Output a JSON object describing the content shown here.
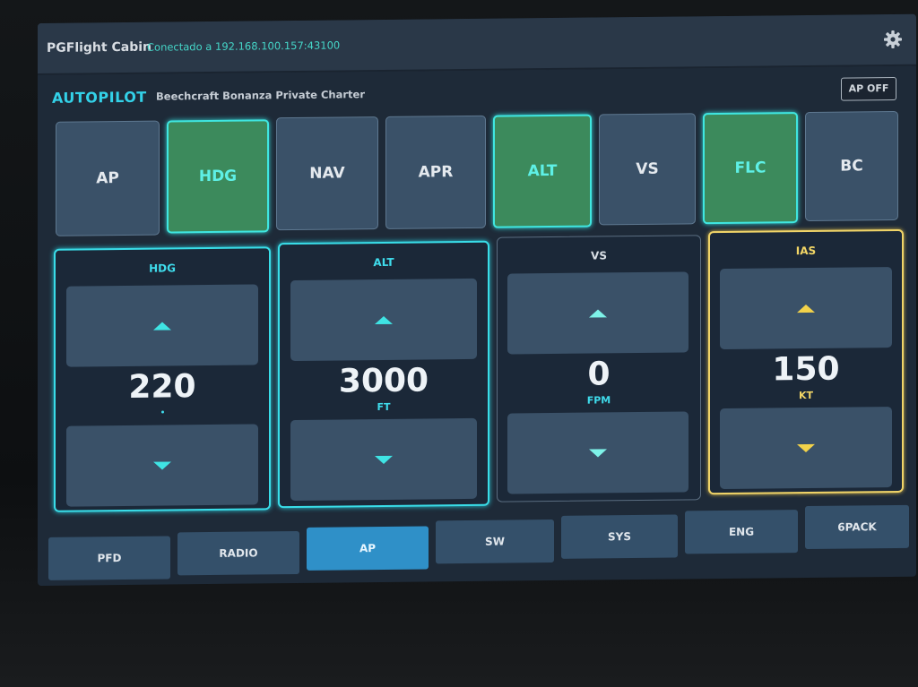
{
  "topbar": {
    "app_title": "PGFlight Cabin",
    "connection": "Conectado a 192.168.100.157:43100",
    "settings_icon": "gear-icon"
  },
  "autopilot": {
    "title": "AUTOPILOT",
    "aircraft": "Beechcraft Bonanza Private Charter",
    "ap_off_label": "AP OFF"
  },
  "modes": [
    {
      "label": "AP",
      "active": false
    },
    {
      "label": "HDG",
      "active": true
    },
    {
      "label": "NAV",
      "active": false
    },
    {
      "label": "APR",
      "active": false
    },
    {
      "label": "ALT",
      "active": true
    },
    {
      "label": "VS",
      "active": false
    },
    {
      "label": "FLC",
      "active": true
    },
    {
      "label": "BC",
      "active": false
    }
  ],
  "panels": {
    "hdg": {
      "label": "HDG",
      "value": "220",
      "unit": "°"
    },
    "alt": {
      "label": "ALT",
      "value": "3000",
      "unit": "FT"
    },
    "vs": {
      "label": "VS",
      "value": "0",
      "unit": "FPM"
    },
    "ias": {
      "label": "IAS",
      "value": "150",
      "unit": "KT"
    }
  },
  "colors": {
    "accent_cyan": "#39dde8",
    "active_green": "#3c8a5c",
    "amber": "#f0d468",
    "active_tab": "#2f90c8"
  },
  "tabs": [
    {
      "label": "PFD",
      "active": false
    },
    {
      "label": "RADIO",
      "active": false
    },
    {
      "label": "AP",
      "active": true
    },
    {
      "label": "SW",
      "active": false
    },
    {
      "label": "SYS",
      "active": false
    },
    {
      "label": "ENG",
      "active": false
    },
    {
      "label": "6PACK",
      "active": false
    }
  ]
}
